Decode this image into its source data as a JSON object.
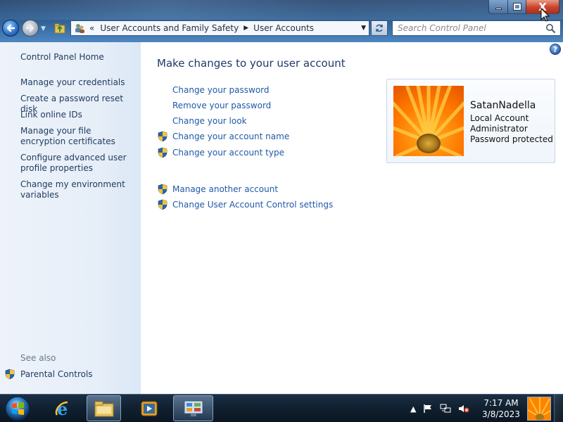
{
  "window": {
    "close_glyph": "X"
  },
  "address": {
    "prefix": "«",
    "crumbs": [
      "User Accounts and Family Safety",
      "User Accounts"
    ]
  },
  "search": {
    "placeholder": "Search Control Panel"
  },
  "left_pane": {
    "home": "Control Panel Home",
    "links": [
      "Manage your credentials",
      "Create a password reset disk",
      "Link online IDs",
      "Manage your file encryption certificates",
      "Configure advanced user profile properties",
      "Change my environment variables"
    ],
    "see_also_label": "See also",
    "see_also_links": [
      "Parental Controls"
    ]
  },
  "main": {
    "title": "Make changes to your user account",
    "help_glyph": "?",
    "tasks": [
      {
        "label": "Change your password",
        "shield": false
      },
      {
        "label": "Remove your password",
        "shield": false
      },
      {
        "label": "Change your look",
        "shield": false
      },
      {
        "label": "Change your account name",
        "shield": true
      },
      {
        "label": "Change your account type",
        "shield": true
      }
    ],
    "other_tasks": [
      {
        "label": "Manage another account",
        "shield": true
      },
      {
        "label": "Change User Account Control settings",
        "shield": true
      }
    ]
  },
  "account": {
    "name": "SatanNadella",
    "type": "Local Account",
    "role": "Administrator",
    "status": "Password protected"
  },
  "taskbar": {
    "time": "7:17 AM",
    "date": "3/8/2023",
    "icons": [
      "start-orb-icon",
      "internet-explorer-icon",
      "explorer-folder-icon",
      "media-player-icon",
      "control-panel-icon"
    ],
    "tray_icons": [
      "show-hidden-icon",
      "action-center-flag-icon",
      "network-icon",
      "volume-muted-icon"
    ]
  },
  "colors": {
    "link": "#1e5aa8",
    "title": "#1e3a6b",
    "left_link": "#1e3a5f",
    "close_red": "#c8432b",
    "shield_yellow": "#f2c630",
    "shield_blue": "#2c62b0"
  }
}
